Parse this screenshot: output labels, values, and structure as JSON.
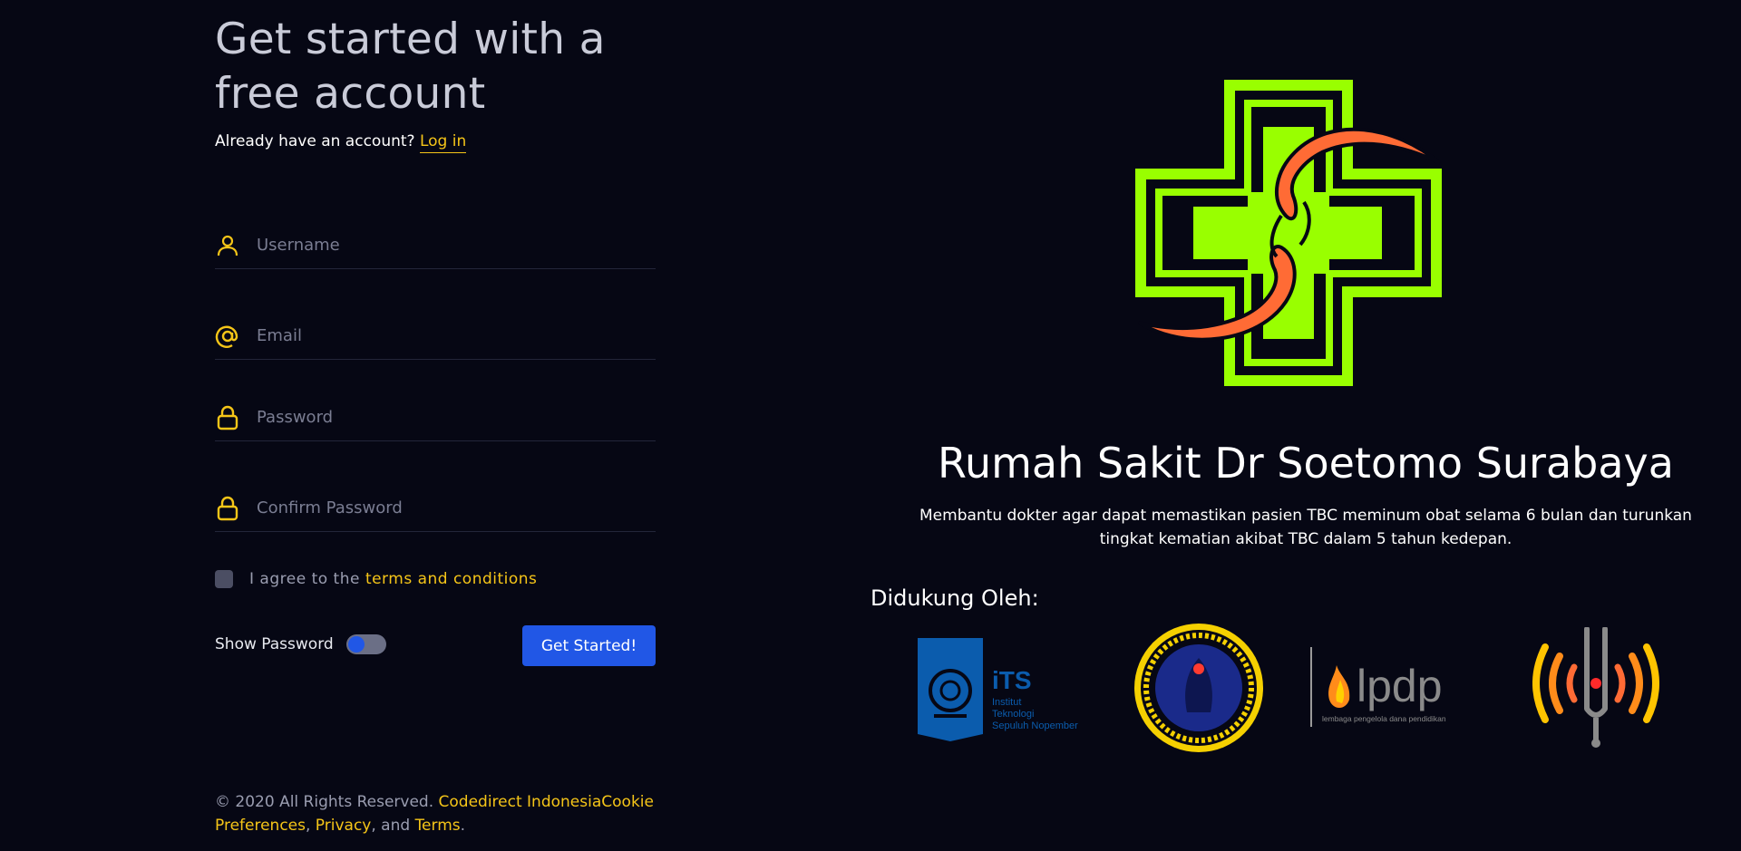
{
  "signup": {
    "title": "Get started with a free account",
    "already_text": "Already have an account?",
    "login_link": "Log in",
    "fields": {
      "username_placeholder": "Username",
      "email_placeholder": "Email",
      "password_placeholder": "Password",
      "confirm_placeholder": "Confirm Password"
    },
    "terms_prefix": "I agree to the",
    "terms_link": "terms and conditions",
    "show_password_label": "Show Password",
    "submit_label": "Get Started!"
  },
  "footer": {
    "copyright": "© 2020 All Rights Reserved.",
    "company_link": "Codedirect Indonesia",
    "cookie_link": "Cookie Preferences",
    "sep1": ",",
    "privacy_link": "Privacy",
    "sep2": ", and",
    "terms_link": "Terms",
    "end": "."
  },
  "hero": {
    "title": "Rumah Sakit Dr Soetomo Surabaya",
    "description": "Membantu dokter agar dapat memastikan pasien TBC meminum obat selama 6 bulan dan turunkan tingkat kematian akibat TBC dalam 5 tahun kedepan.",
    "supported_by": "Didukung Oleh:"
  },
  "partners": {
    "its": {
      "brand": "iTS",
      "line1": "Institut",
      "line2": "Teknologi",
      "line3": "Sepuluh Nopember"
    },
    "lpdp": {
      "brand": "lpdp",
      "tagline": "lembaga pengelola dana pendidikan"
    }
  },
  "colors": {
    "background": "#060714",
    "accent_yellow": "#f5c518",
    "primary_blue": "#2157e6",
    "logo_green": "#99ff00",
    "logo_orange": "#ff6b35"
  },
  "icons": {
    "username": "user-icon",
    "email": "at-icon",
    "password": "lock-icon",
    "confirm": "lock-icon"
  }
}
